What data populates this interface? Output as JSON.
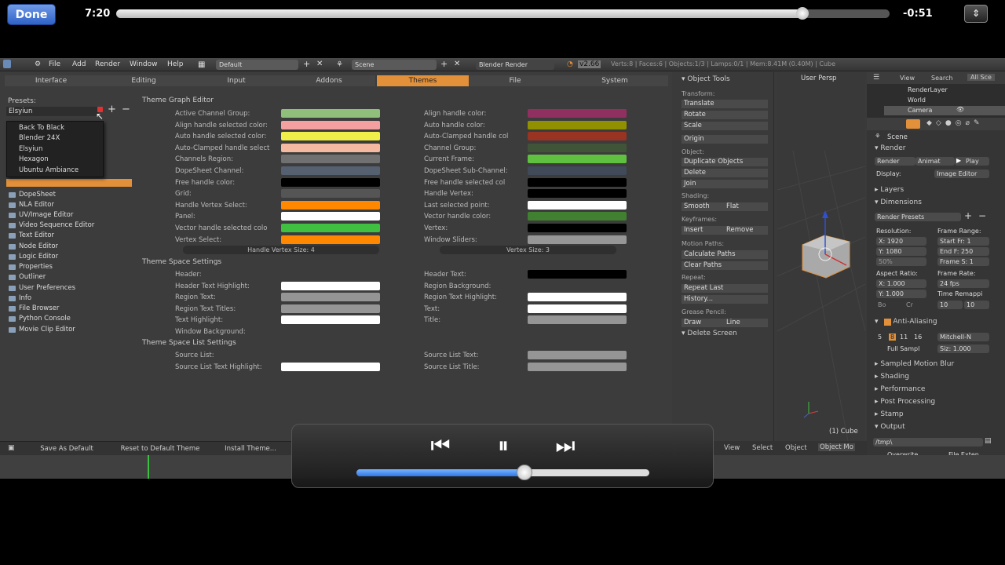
{
  "player": {
    "done_label": "Done",
    "time_elapsed": "7:20",
    "time_remaining": "-0:51",
    "progress_fraction": 0.887,
    "volume_fraction": 0.575
  },
  "menubar": {
    "items": [
      "File",
      "Add",
      "Render",
      "Window",
      "Help"
    ],
    "layout": "Default",
    "scene": "Scene",
    "engine": "Blender Render",
    "version": "v2.66",
    "stats": "Verts:8 | Faces:6 | Objects:1/3 | Lamps:0/1 | Mem:8.41M (0.40M) | Cube"
  },
  "tabs": [
    "Interface",
    "Editing",
    "Input",
    "Addons",
    "Themes",
    "File",
    "System"
  ],
  "active_tab": "Themes",
  "presets": {
    "label": "Presets:",
    "current": "Elsyiun",
    "options": [
      "Back To Black",
      "Blender 24X",
      "Elsyiun",
      "Hexagon",
      "Ubuntu Ambiance"
    ]
  },
  "editors": [
    "DopeSheet",
    "NLA Editor",
    "UV/Image Editor",
    "Video Sequence Editor",
    "Text Editor",
    "Node Editor",
    "Logic Editor",
    "Properties",
    "Outliner",
    "User Preferences",
    "Info",
    "File Browser",
    "Python Console",
    "Movie Clip Editor"
  ],
  "theme_graph": {
    "title": "Theme Graph Editor",
    "left": [
      {
        "label": "Active Channel Group:",
        "color": "#8fbf7a"
      },
      {
        "label": "Align handle selected color:",
        "color": "#f4a0a0"
      },
      {
        "label": "Auto handle selected color:",
        "color": "#f0ee48"
      },
      {
        "label": "Auto-Clamped handle select",
        "color": "#f5b8a0"
      },
      {
        "label": "Channels Region:",
        "color": "#707070"
      },
      {
        "label": "DopeSheet Channel:",
        "color": "#556070"
      },
      {
        "label": "Free handle color:",
        "color": "#000000"
      },
      {
        "label": "Grid:",
        "color": "#555555"
      },
      {
        "label": "Handle Vertex Select:",
        "color": "#ff8800"
      },
      {
        "label": "Panel:",
        "color": "#ffffff"
      },
      {
        "label": "Vector handle selected colo",
        "color": "#40c040"
      },
      {
        "label": "Vertex Select:",
        "color": "#ff8800"
      }
    ],
    "right": [
      {
        "label": "Align handle color:",
        "color": "#903060"
      },
      {
        "label": "Auto handle color:",
        "color": "#909000"
      },
      {
        "label": "Auto-Clamped handle col",
        "color": "#993322"
      },
      {
        "label": "Channel Group:",
        "color": "#405538"
      },
      {
        "label": "Current Frame:",
        "color": "#60c040"
      },
      {
        "label": "DopeSheet Sub-Channel:",
        "color": "#404a58"
      },
      {
        "label": "Free handle selected col",
        "color": "#000000"
      },
      {
        "label": "Handle Vertex:",
        "color": "#000000"
      },
      {
        "label": "Last selected point:",
        "color": "#ffffff"
      },
      {
        "label": "Vector handle color:",
        "color": "#408030"
      },
      {
        "label": "Vertex:",
        "color": "#000000"
      },
      {
        "label": "Window Sliders:",
        "color": "#969696"
      }
    ],
    "handle_vertex_size": "Handle Vertex Size: 4",
    "vertex_size": "Vertex Size: 3"
  },
  "theme_space": {
    "title": "Theme Space Settings",
    "left": [
      {
        "label": "Header:",
        "color": "#3c3c3c"
      },
      {
        "label": "Header Text Highlight:",
        "color": "#ffffff"
      },
      {
        "label": "Region Text:",
        "color": "#959595"
      },
      {
        "label": "Region Text Titles:",
        "color": "#959595"
      },
      {
        "label": "Text Highlight:",
        "color": "#ffffff"
      },
      {
        "label": "Window Background:",
        "color": "#3c3c3c"
      }
    ],
    "right": [
      {
        "label": "Header Text:",
        "color": "#000000"
      },
      {
        "label": "Region Background:",
        "color": "#3c3c3c"
      },
      {
        "label": "Region Text Highlight:",
        "color": "#ffffff"
      },
      {
        "label": "Text:",
        "color": "#ffffff"
      },
      {
        "label": "Title:",
        "color": "#959595"
      }
    ]
  },
  "theme_space_list": {
    "title": "Theme Space List Settings",
    "left": [
      {
        "label": "Source List:",
        "color": "#3c3c3c"
      },
      {
        "label": "Source List Text Highlight:",
        "color": "#ffffff"
      }
    ],
    "right": [
      {
        "label": "Source List Text:",
        "color": "#959595"
      },
      {
        "label": "Source List Title:",
        "color": "#959595"
      }
    ]
  },
  "bottom_buttons": [
    "Save As Default",
    "Reset to Default Theme",
    "Install Theme..."
  ],
  "object_tools": {
    "title": "Object Tools",
    "transform_label": "Transform:",
    "transform": [
      "Translate",
      "Rotate",
      "Scale"
    ],
    "origin": "Origin",
    "object_label": "Object:",
    "object": [
      "Duplicate Objects",
      "Delete",
      "Join"
    ],
    "shading_label": "Shading:",
    "smooth": "Smooth",
    "flat": "Flat",
    "keyframes_label": "Keyframes:",
    "insert": "Insert",
    "remove": "Remove",
    "motion_label": "Motion Paths:",
    "motion": [
      "Calculate Paths",
      "Clear Paths"
    ],
    "repeat_label": "Repeat:",
    "repeat": [
      "Repeat Last",
      "History..."
    ],
    "grease_label": "Grease Pencil:",
    "draw": "Draw",
    "line": "Line",
    "delete_screen": "Delete Screen"
  },
  "viewport": {
    "label": "User Persp",
    "object_label": "(1) Cube",
    "header": [
      "View",
      "Select",
      "Object",
      "Object Mo"
    ]
  },
  "outliner": {
    "header": [
      "View",
      "Search",
      "All Sce"
    ],
    "items": [
      "RenderLayer",
      "World",
      "Camera"
    ]
  },
  "properties": {
    "scene": "Scene",
    "render_header": "Render",
    "render_btn": "Render",
    "animation_btn": "Animat",
    "play_btn": "Play",
    "display_label": "Display:",
    "display_value": "Image Editor",
    "layers": "Layers",
    "dimensions": "Dimensions",
    "render_presets": "Render Presets",
    "resolution": "Resolution:",
    "frame_range": "Frame Range:",
    "res_x": "X: 1920",
    "res_y": "Y: 1080",
    "res_pct": "50%",
    "start_frame": "Start Fr: 1",
    "end_frame": "End F: 250",
    "frame_step": "Frame S: 1",
    "aspect": "Aspect Ratio:",
    "frame_rate": "Frame Rate:",
    "asp_x": "X: 1.000",
    "asp_y": "Y: 1.000",
    "fps": "24 fps",
    "time_remap": "Time Remappi",
    "bo": "Bo",
    "cr": "Cr",
    "remap_old": "10",
    "remap_new": "10",
    "aa": "Anti-Aliasing",
    "aa_samples": [
      "5",
      "8",
      "11",
      "16"
    ],
    "aa_filter": "Mitchell-N",
    "full_sample": "Full Sampl",
    "aa_size": "Siz: 1.000",
    "motion_blur": "Sampled Motion Blur",
    "shading": "Shading",
    "performance": "Performance",
    "post": "Post Processing",
    "stamp": "Stamp",
    "output": "Output",
    "output_path": "/tmp\\",
    "overwrite": "Overwrite",
    "file_ext": "File Exten"
  },
  "colors": {
    "accent": "#e2903a",
    "ios_blue": "#2f62c8"
  }
}
